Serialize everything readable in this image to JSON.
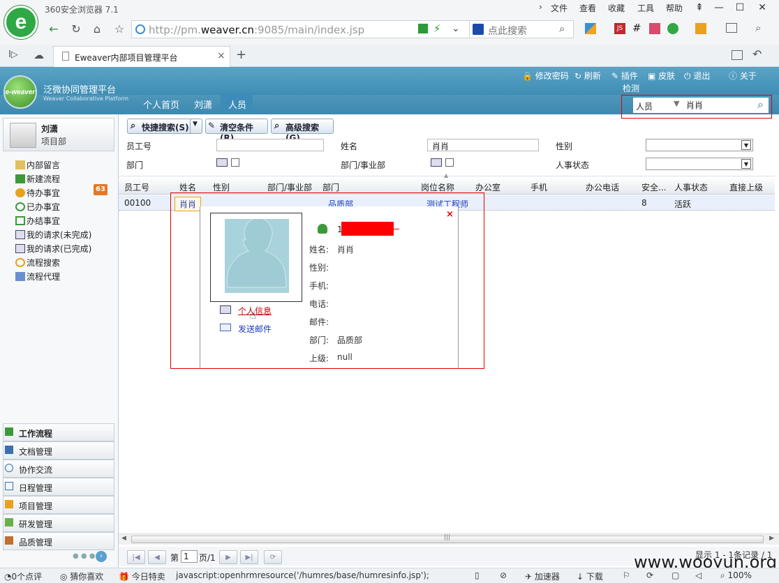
{
  "browser": {
    "title": "360安全浏览器 7.1",
    "menus": [
      "文件",
      "查看",
      "收藏",
      "工具",
      "帮助"
    ],
    "url_prefix": "http://pm.",
    "url_domain": "weaver.cn",
    "url_suffix": ":9085/main/index.jsp",
    "search_placeholder": "点此搜索",
    "tab_title": "Eweaver内部项目管理平台",
    "tab_close": "×",
    "new_tab": "+"
  },
  "app": {
    "logo_text": "e-weaver",
    "brand": "泛微协同管理平台",
    "brand_sub": "Weaver Collaborative Platform",
    "nav": [
      "个人首页",
      "刘潇",
      "人员"
    ],
    "top_links": [
      "修改密码",
      "刷新",
      "插件",
      "检测",
      "皮肤",
      "退出",
      "关于"
    ],
    "search_type": "人员",
    "search_value": "肖肖"
  },
  "sidebar": {
    "user_name": "刘潇",
    "user_dept": "项目部",
    "items": [
      "内部留言",
      "新建流程",
      "待办事宜",
      "已办事宜",
      "办结事宜",
      "我的请求(未完成)",
      "我的请求(已完成)",
      "流程搜索",
      "流程代理"
    ],
    "badge": "63",
    "accordion": [
      "工作流程",
      "文档管理",
      "协作交流",
      "日程管理",
      "项目管理",
      "研发管理",
      "品质管理"
    ]
  },
  "toolbar": {
    "quick_search": "快捷搜索(S)",
    "clear": "清空条件(R)",
    "advanced": "高级搜索(G)"
  },
  "form": {
    "emp_no_label": "员工号",
    "name_label": "姓名",
    "name_value": "肖肖",
    "gender_label": "性别",
    "dept_label": "部门",
    "bu_label": "部门/事业部",
    "status_label": "人事状态"
  },
  "grid": {
    "columns": [
      "员工号",
      "姓名",
      "性别",
      "部门/事业部",
      "部门",
      "岗位名称",
      "办公室",
      "手机",
      "办公电话",
      "安全...",
      "人事状态",
      "直接上级"
    ],
    "row": {
      "emp_no": "00100",
      "name": "肖肖",
      "dept": "品质部",
      "position": "测试工程师",
      "security": "8",
      "status": "活跃"
    }
  },
  "popup": {
    "close": "×",
    "id_prefix": "1",
    "personal_info": "个人信息",
    "send_mail": "发送邮件",
    "labels": [
      "姓名:",
      "性别:",
      "手机:",
      "电话:",
      "邮件:",
      "部门:",
      "上级:"
    ],
    "name": "肖肖",
    "dept": "品质部",
    "superior": "null"
  },
  "pager": {
    "page_prefix": "第",
    "page_value": "1",
    "page_suffix": "页/1",
    "summary": "显示 1 - 1条记录 / 1"
  },
  "statusbar": {
    "items": [
      "0个点评",
      "猜你喜欢",
      "今日特卖"
    ],
    "js_status": "javascript:openhrmresource('/humres/base/humresinfo.jsp');",
    "right": [
      "加速器",
      "下载",
      "100%"
    ]
  },
  "watermark": "www.wooyun.org",
  "colors": {
    "header": "#2d7fa9",
    "highlight": "#e00000",
    "link": "#1a3cb8"
  }
}
